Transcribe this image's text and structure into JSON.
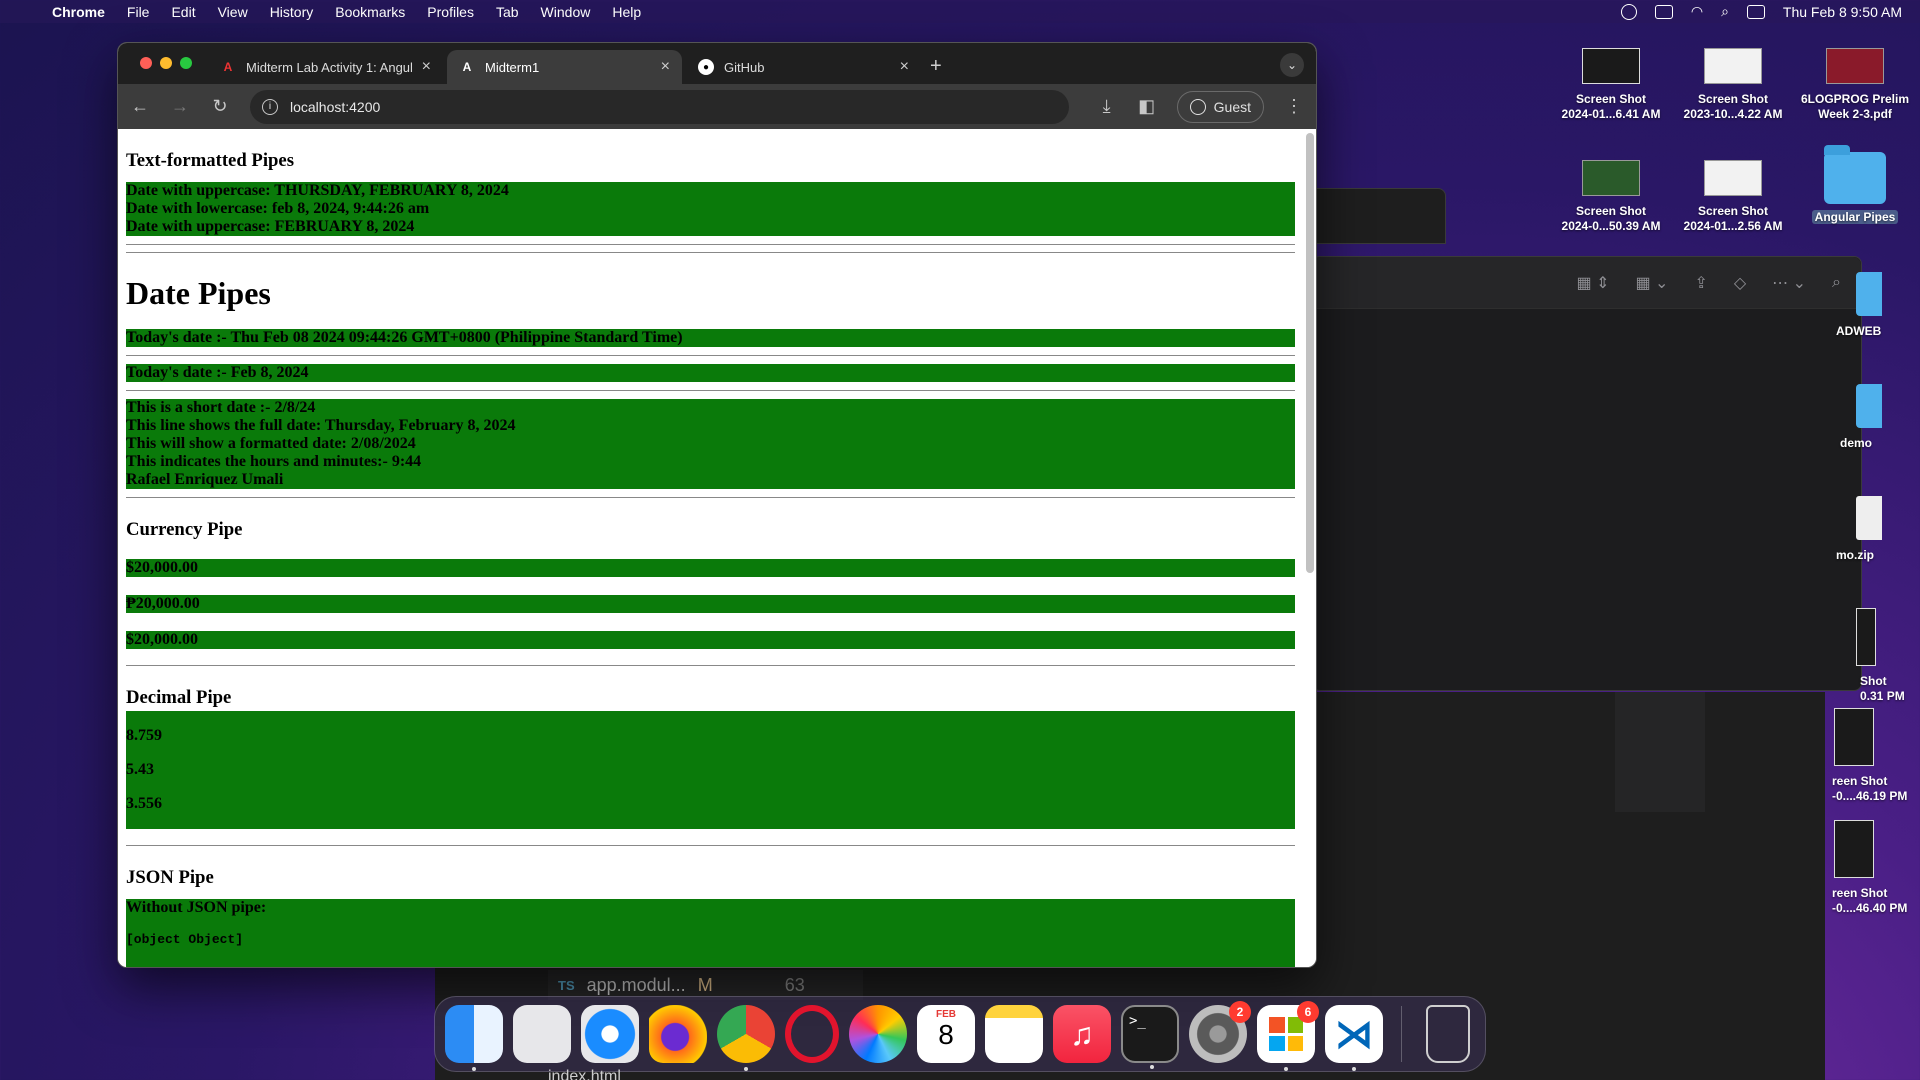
{
  "menubar": {
    "app": "Chrome",
    "items": [
      "File",
      "Edit",
      "View",
      "History",
      "Bookmarks",
      "Profiles",
      "Tab",
      "Window",
      "Help"
    ],
    "clock": "Thu Feb 8  9:50 AM"
  },
  "browser": {
    "tabs": [
      {
        "title": "Midterm Lab Activity 1: Angul",
        "icon": "angular-logo-icon"
      },
      {
        "title": "Midterm1",
        "icon": "angular-logo-icon"
      },
      {
        "title": "GitHub",
        "icon": "github-icon"
      }
    ],
    "url": "localhost:4200",
    "profile": "Guest"
  },
  "page": {
    "text_pipes": {
      "heading": "Text-formatted Pipes",
      "lines": [
        "Date with uppercase: THURSDAY, FEBRUARY 8, 2024",
        "Date with lowercase: feb 8, 2024, 9:44:26 am",
        "Date with uppercase: FEBRUARY 8, 2024"
      ]
    },
    "date_pipes": {
      "heading": "Date Pipes",
      "full": "Today's date :- Thu Feb 08 2024 09:44:26 GMT+0800 (Philippine Standard Time)",
      "short_today": "Today's date :- Feb 8, 2024",
      "lines": [
        "This is a short date :- 2/8/24",
        "This line shows the full date: Thursday, February 8, 2024",
        "This will show a formatted date: 2/08/2024",
        "This indicates the hours and minutes:- 9:44",
        "Rafael Enriquez Umali"
      ]
    },
    "currency": {
      "heading": "Currency Pipe",
      "values": [
        "$20,000.00",
        "₱20,000.00",
        "$20,000.00"
      ]
    },
    "decimal": {
      "heading": "Decimal Pipe",
      "values": [
        "8.759",
        "5.43",
        "3.556"
      ]
    },
    "json": {
      "heading": "JSON Pipe",
      "label": "Without JSON pipe:",
      "value": "[object Object]"
    }
  },
  "desktop": {
    "icons": [
      {
        "label1": "Screen Shot",
        "label2": "2024-01...6.41 AM"
      },
      {
        "label1": "Screen Shot",
        "label2": "2023-10...4.22 AM"
      },
      {
        "label1": "6LOGPROG Prelim",
        "label2": "Week 2-3.pdf"
      },
      {
        "label1": "Screen Shot",
        "label2": "2024-0...50.39 AM"
      },
      {
        "label1": "Screen Shot",
        "label2": "2024-01...2.56 AM"
      },
      {
        "label1": "Angular Pipes",
        "label2": ""
      }
    ],
    "partial": [
      {
        "l1": "ADWEB",
        "l2": ""
      },
      {
        "l1": "demo",
        "l2": ""
      },
      {
        "l1": "mo.zip",
        "l2": ""
      },
      {
        "l1": "Shot",
        "l2": "0.31 PM"
      },
      {
        "l1": "reen Shot",
        "l2": "-0....46.19 PM"
      },
      {
        "l1": "reen Shot",
        "l2": "-0....46.40 PM"
      }
    ]
  },
  "editor": {
    "tab_lang": "TS",
    "tab_file": "app.modul...",
    "tab_status": "M",
    "line": "63",
    "bottom_file": "index.html"
  },
  "dock": {
    "calendar_month": "FEB",
    "calendar_day": "8",
    "settings_badge": "2",
    "store_badge": "6"
  }
}
